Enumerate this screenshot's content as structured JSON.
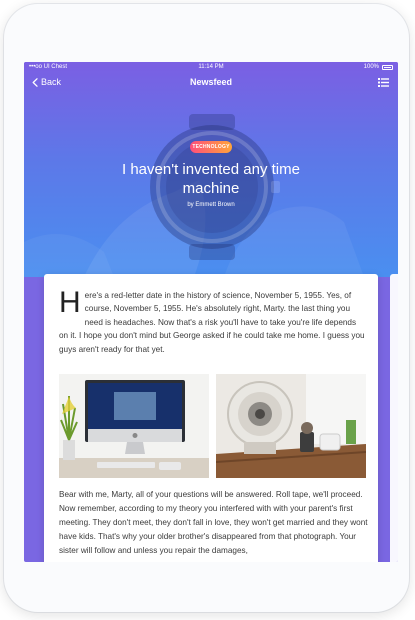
{
  "status_bar": {
    "carrier": "•••oo UI Chest",
    "time": "11:14 PM",
    "battery": "100%"
  },
  "nav": {
    "back_label": "Back",
    "title": "Newsfeed"
  },
  "article": {
    "category": "TECHNOLOGY",
    "title": "I haven't invented any time machine",
    "byline": "by Emmett Brown",
    "drop_cap": "H",
    "paragraph1": "ere's a red-letter date in the history of science, November 5, 1955. Yes, of course, November 5, 1955. He's absolutely right, Marty. the last thing you need is headaches. Now that's a risk you'll have to take you're life depends on it. I hope you don't mind but George asked if he could take me home. I guess you guys aren't ready for that yet.",
    "paragraph2": "Bear with me, Marty, all of your questions will be answered. Roll tape, we'll proceed. Now remember, according to my theory you interfered with with your parent's first meeting. They don't meet, they don't fall in love, they won't get married and they wont have kids. That's why your older brother's disappeared from that photograph. Your sister will follow and unless you repair the damages,"
  },
  "colors": {
    "gradient_top": "#7b5fe3",
    "gradient_bottom": "#4a8ff0",
    "badge_start": "#ff4f7b",
    "badge_end": "#ffa43a"
  }
}
